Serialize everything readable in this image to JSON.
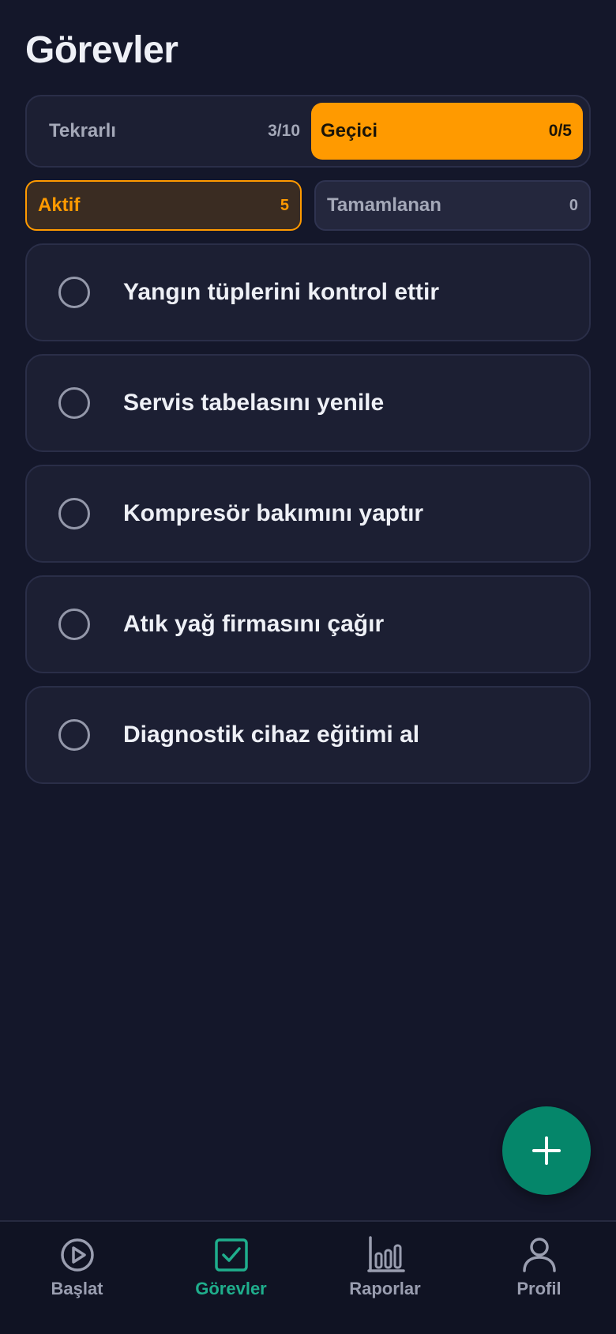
{
  "header": {
    "title": "Görevler"
  },
  "type_selector": {
    "items": [
      {
        "label": "Tekrarlı",
        "count": "3/10",
        "active": false
      },
      {
        "label": "Geçici",
        "count": "0/5",
        "active": true
      }
    ]
  },
  "status_filter": {
    "items": [
      {
        "label": "Aktif",
        "count": "5",
        "active": true
      },
      {
        "label": "Tamamlanan",
        "count": "0",
        "active": false
      }
    ]
  },
  "tasks": [
    {
      "title": "Yangın tüplerini kontrol ettir",
      "done": false
    },
    {
      "title": "Servis tabelasını yenile",
      "done": false
    },
    {
      "title": "Kompresör bakımını yaptır",
      "done": false
    },
    {
      "title": "Atık yağ firmasını çağır",
      "done": false
    },
    {
      "title": "Diagnostik cihaz eğitimi al",
      "done": false
    }
  ],
  "fab": {
    "icon": "plus-icon"
  },
  "tabbar": {
    "items": [
      {
        "label": "Başlat",
        "icon": "play-circle-icon",
        "active": false
      },
      {
        "label": "Görevler",
        "icon": "checkbox-icon",
        "active": true
      },
      {
        "label": "Raporlar",
        "icon": "bar-chart-icon",
        "active": false
      },
      {
        "label": "Profil",
        "icon": "user-icon",
        "active": false
      }
    ]
  },
  "colors": {
    "background": "#14172a",
    "accent_orange": "#ff9a00",
    "accent_green": "#05866a",
    "tab_active": "#1fae8c"
  }
}
